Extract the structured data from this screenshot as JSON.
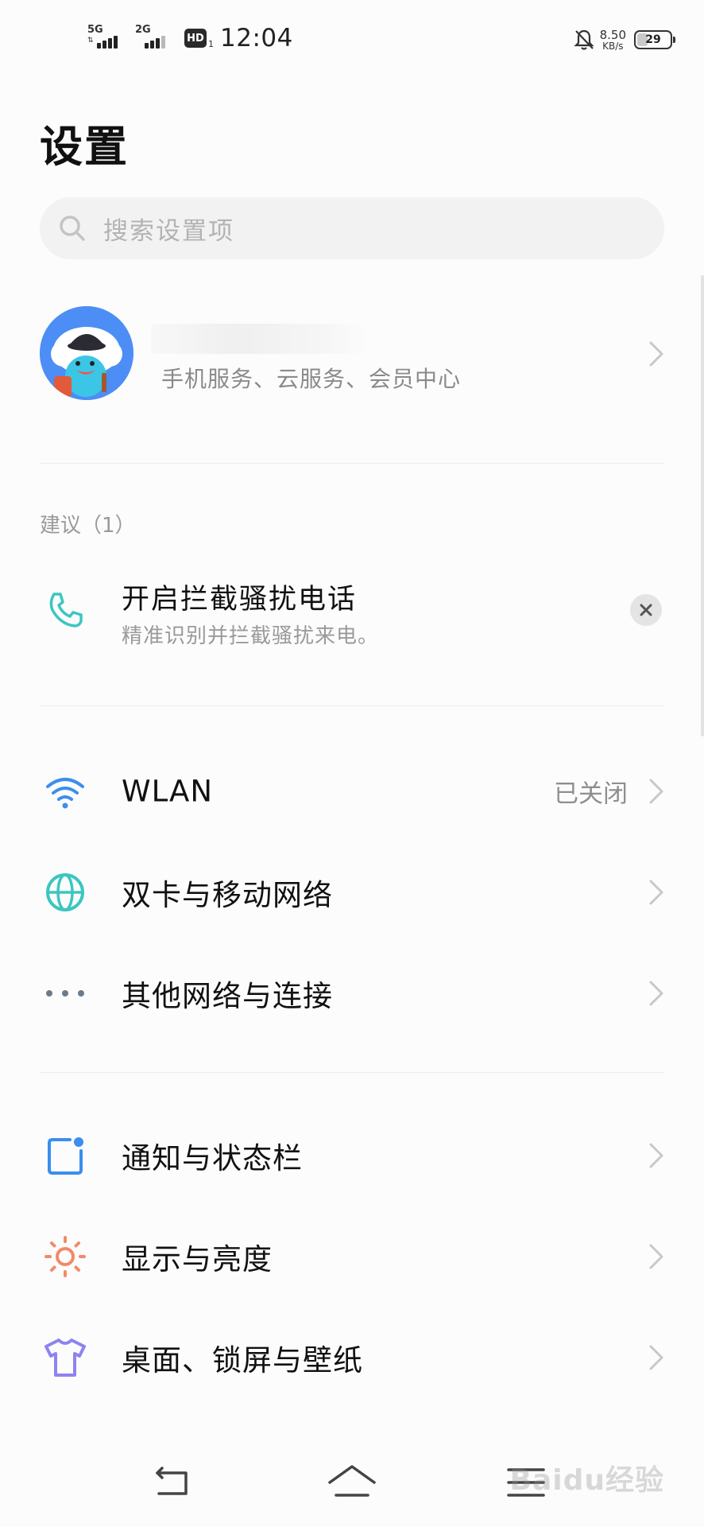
{
  "status_bar": {
    "sim1_type": "5G",
    "sim2_type": "2G",
    "hd_label": "HD",
    "hd_sub": "1",
    "time": "12:04",
    "net_speed_value": "8.50",
    "net_speed_unit": "KB/s",
    "battery_level": "29",
    "battery_fraction": 0.29,
    "icons": [
      "signal-icon",
      "hd-voice-icon",
      "bell-off-icon",
      "battery-icon"
    ]
  },
  "page": {
    "title": "设置"
  },
  "search": {
    "placeholder": "搜索设置项",
    "icon": "search-icon"
  },
  "account": {
    "name": "",
    "subtitle": "手机服务、云服务、会员中心",
    "avatar_icon": "avatar-icon"
  },
  "suggestions": {
    "header": "建议（1）",
    "item": {
      "title": "开启拦截骚扰电话",
      "subtitle": "精准识别并拦截骚扰来电。",
      "icon": "phone-icon"
    }
  },
  "settings_groups": [
    {
      "items": [
        {
          "label": "WLAN",
          "value": "已关闭",
          "icon": "wifi-icon"
        },
        {
          "label": "双卡与移动网络",
          "value": "",
          "icon": "globe-icon"
        },
        {
          "label": "其他网络与连接",
          "value": "",
          "icon": "more-dots-icon"
        }
      ]
    },
    {
      "items": [
        {
          "label": "通知与状态栏",
          "value": "",
          "icon": "notification-icon"
        },
        {
          "label": "显示与亮度",
          "value": "",
          "icon": "brightness-icon"
        },
        {
          "label": "桌面、锁屏与壁纸",
          "value": "",
          "icon": "tshirt-icon"
        }
      ]
    }
  ],
  "nav": {
    "watermark": "Baidu经验",
    "icons": [
      "back-icon",
      "home-icon",
      "menu-icon"
    ]
  },
  "colors": {
    "accent_blue": "#3a8ef0",
    "teal": "#3cc6c0",
    "orange": "#f28a6a",
    "purple": "#8e83f0"
  }
}
